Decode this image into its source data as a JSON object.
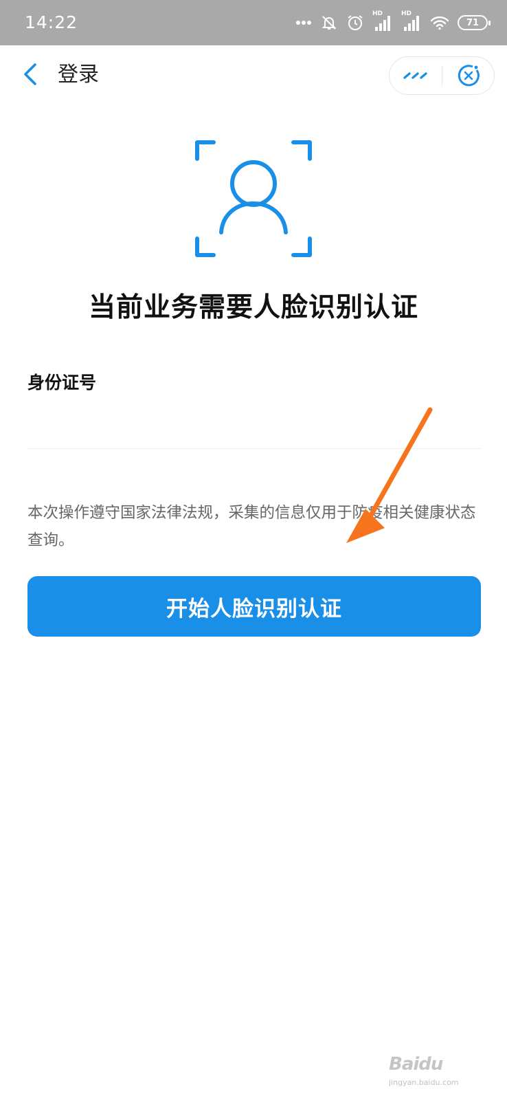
{
  "status_bar": {
    "time": "14:22",
    "hd_label": "HD",
    "battery": "71",
    "icons": [
      "more-dots-icon",
      "bell-off-icon",
      "alarm-icon",
      "signal-hd-icon",
      "signal-hd-icon",
      "wifi-icon",
      "battery-icon"
    ]
  },
  "nav": {
    "title": "登录",
    "back_icon": "chevron-left-icon",
    "more_icon": "more-dots-icon",
    "close_icon": "close-circle-icon"
  },
  "face_icon": "face-scan-icon",
  "main_title": "当前业务需要人脸识别认证",
  "form": {
    "id_label": "身份证号",
    "id_value": "",
    "id_placeholder": ""
  },
  "notice": "本次操作遵守国家法律法规，采集的信息仅用于防疫相关健康状态查询。",
  "primary_button": "开始人脸识别认证",
  "annotation_arrow": "arrow-icon",
  "watermark": {
    "logo": "Baidu",
    "sub": "jingyan.baidu.com"
  },
  "colors": {
    "accent": "#1a8fe8",
    "status_bar": "#a9a9a9",
    "annotation": "#f7741e",
    "title": "#111111",
    "notice_text": "#666666"
  }
}
